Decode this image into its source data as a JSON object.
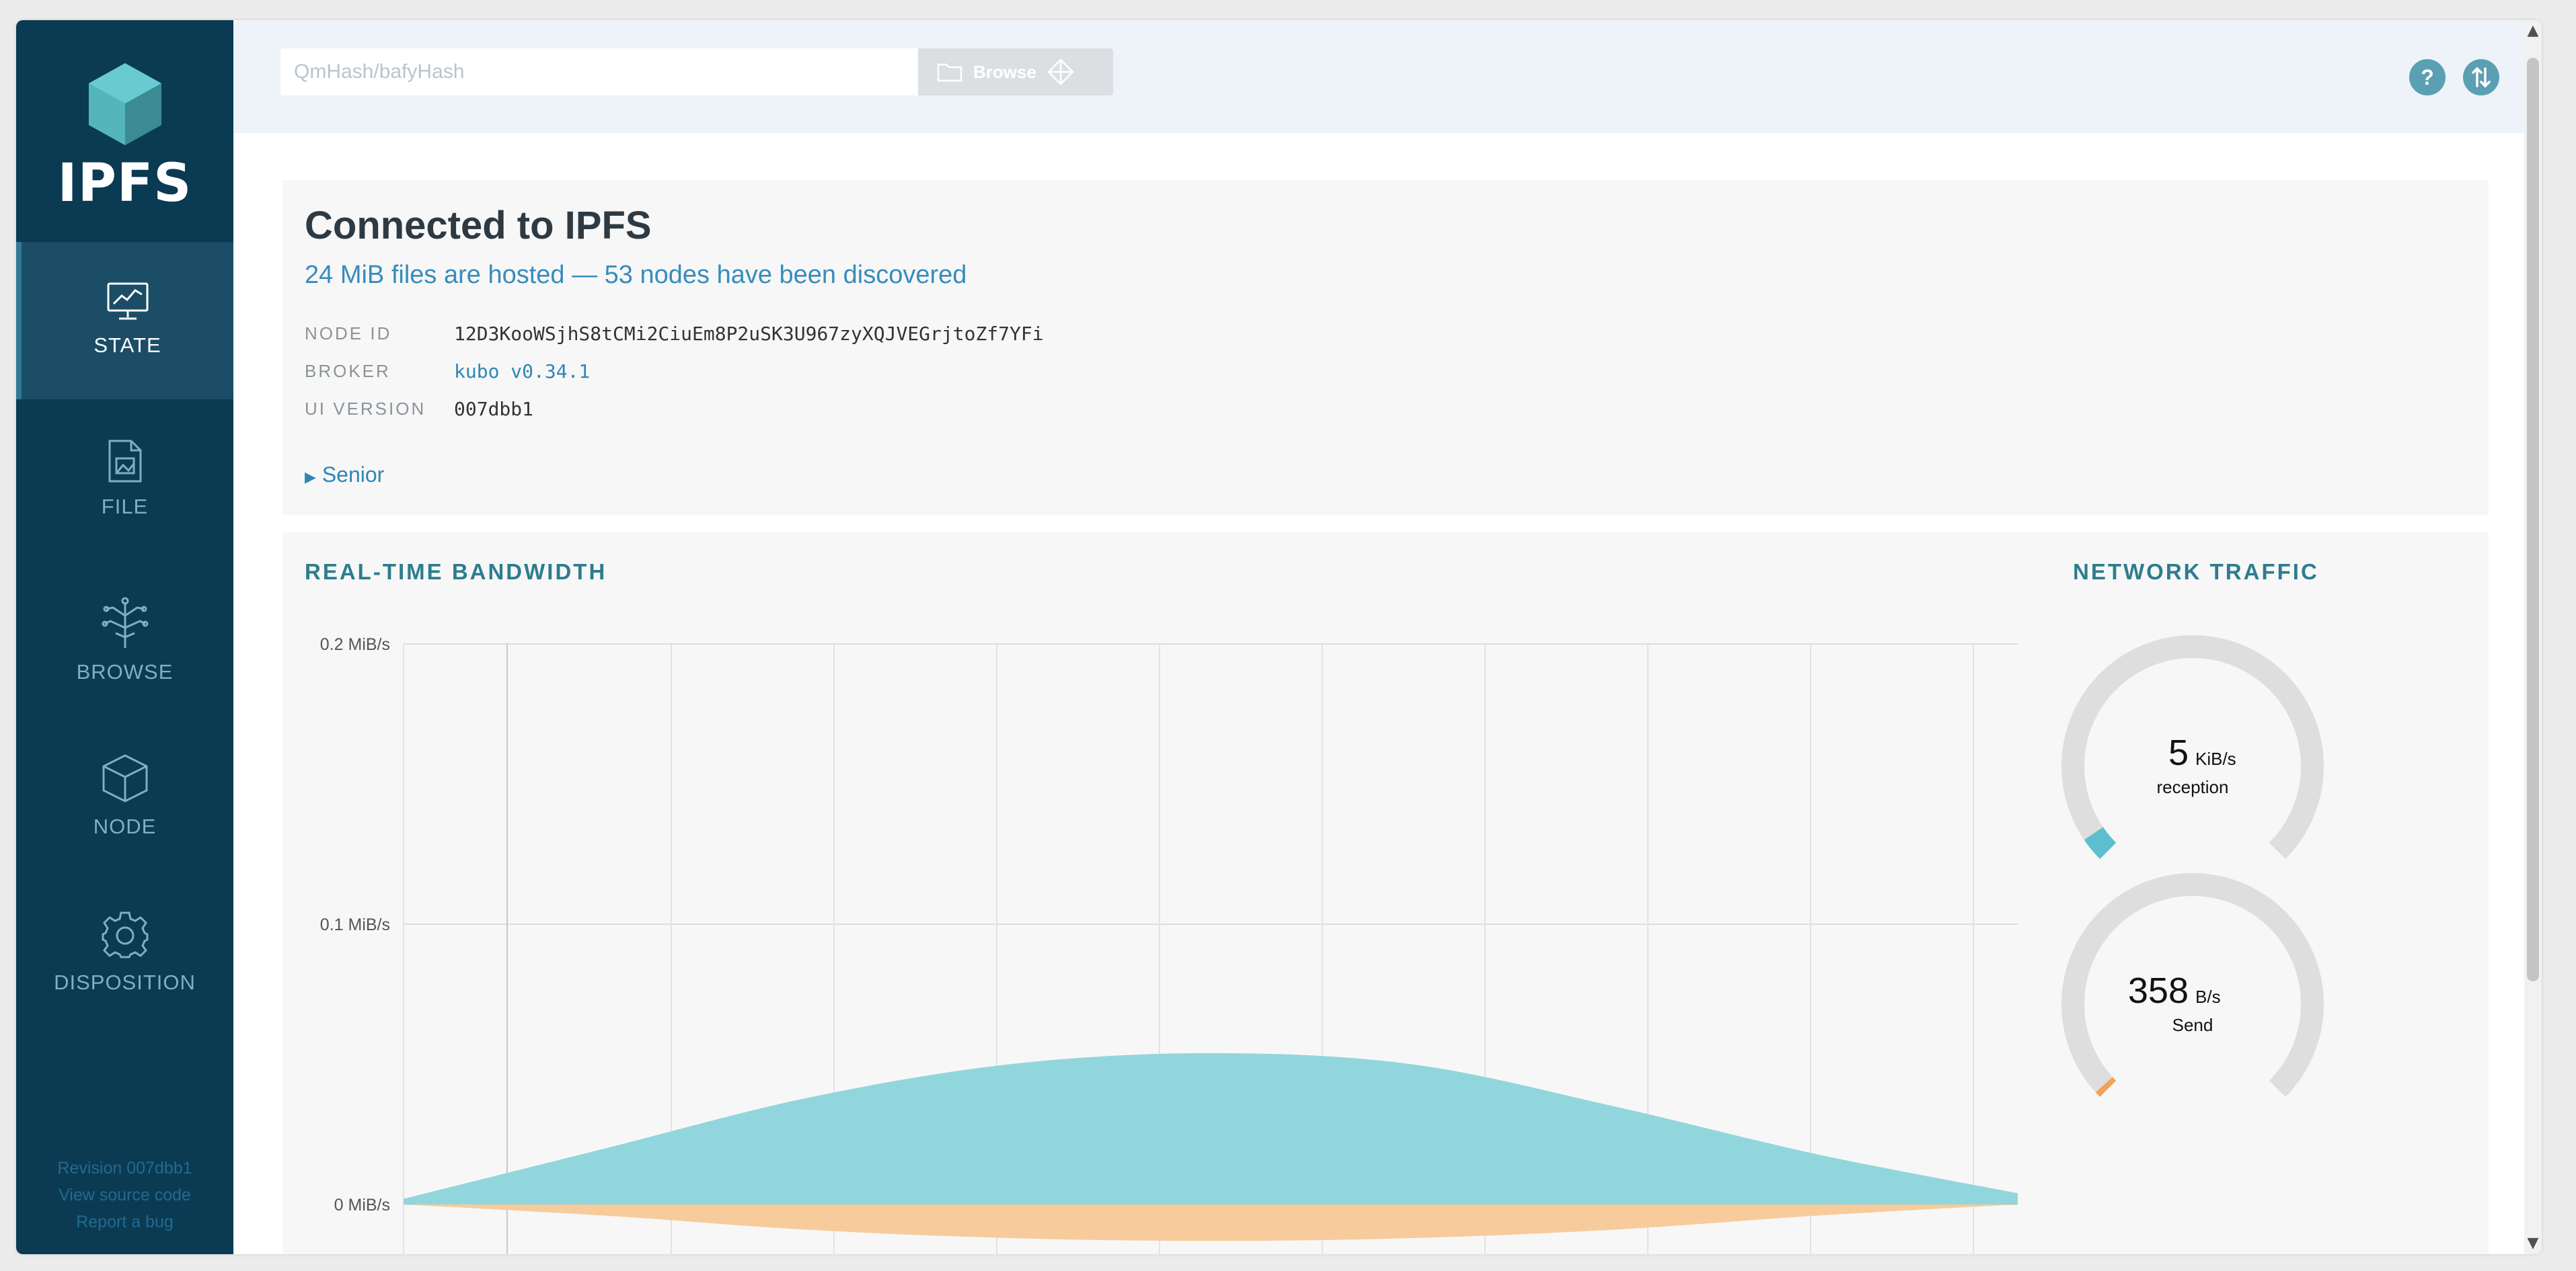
{
  "sidebar": {
    "logo_text": "IPFS",
    "items": [
      {
        "id": "state",
        "label": "STATE",
        "icon": "monitor-chart-icon",
        "active": true
      },
      {
        "id": "file",
        "label": "FILE",
        "icon": "document-icon",
        "active": false
      },
      {
        "id": "browse",
        "label": "BROWSE",
        "icon": "tree-network-icon",
        "active": false
      },
      {
        "id": "node",
        "label": "NODE",
        "icon": "cube-icon",
        "active": false
      },
      {
        "id": "disposition",
        "label": "DISPOSITION",
        "icon": "gear-icon",
        "active": false
      }
    ],
    "footer": {
      "revision": "Revision 007dbb1",
      "source": "View source code",
      "bug": "Report a bug"
    }
  },
  "topbar": {
    "search_placeholder": "QmHash/bafyHash",
    "browse_label": "Browse",
    "help_icon": "help-icon",
    "connection_icon": "transfer-arrows-icon"
  },
  "status": {
    "title": "Connected to IPFS",
    "summary": "24 MiB files are hosted — 53 nodes have been discovered",
    "rows": [
      {
        "key": "NODE ID",
        "value": "12D3KooWSjhS8tCMi2CiuEm8P2uSK3U967zyXQJVEGrjtoZf7YFi"
      },
      {
        "key": "BROKER",
        "value": "kubo v0.34.1"
      },
      {
        "key": "UI VERSION",
        "value": "007dbb1"
      }
    ],
    "advanced_label": "Senior"
  },
  "bandwidth": {
    "heading": "REAL-TIME BANDWIDTH",
    "traffic_heading": "NETWORK TRAFFIC",
    "colors": {
      "incoming": "#92d6dd",
      "outgoing": "#f7cb9b",
      "gauge_track": "#dedede",
      "gauge_in": "#5bbfcf",
      "gauge_out": "#f2a35a"
    }
  },
  "gauges": [
    {
      "value": "5",
      "unit": "KiB/s",
      "label": "reception",
      "fraction": 0.04
    },
    {
      "value": "358",
      "unit": "B/s",
      "label": "Send",
      "fraction": 0.01
    }
  ],
  "chart_data": {
    "type": "area",
    "title": "REAL-TIME BANDWIDTH",
    "yticks": [
      "0.2 MiB/s",
      "0.1 MiB/s",
      "0 MiB/s"
    ],
    "ylim": [
      -0.02,
      0.2
    ],
    "x": [
      0,
      1,
      2,
      3,
      4,
      5,
      6,
      7,
      8
    ],
    "series": [
      {
        "values": [
          0.002,
          0.02,
          0.038,
          0.05,
          0.054,
          0.05,
          0.035,
          0.018,
          0.004
        ]
      },
      {
        "values": [
          0.0,
          -0.004,
          -0.009,
          -0.012,
          -0.013,
          -0.012,
          -0.009,
          -0.004,
          0.0
        ]
      }
    ],
    "grid": true
  }
}
